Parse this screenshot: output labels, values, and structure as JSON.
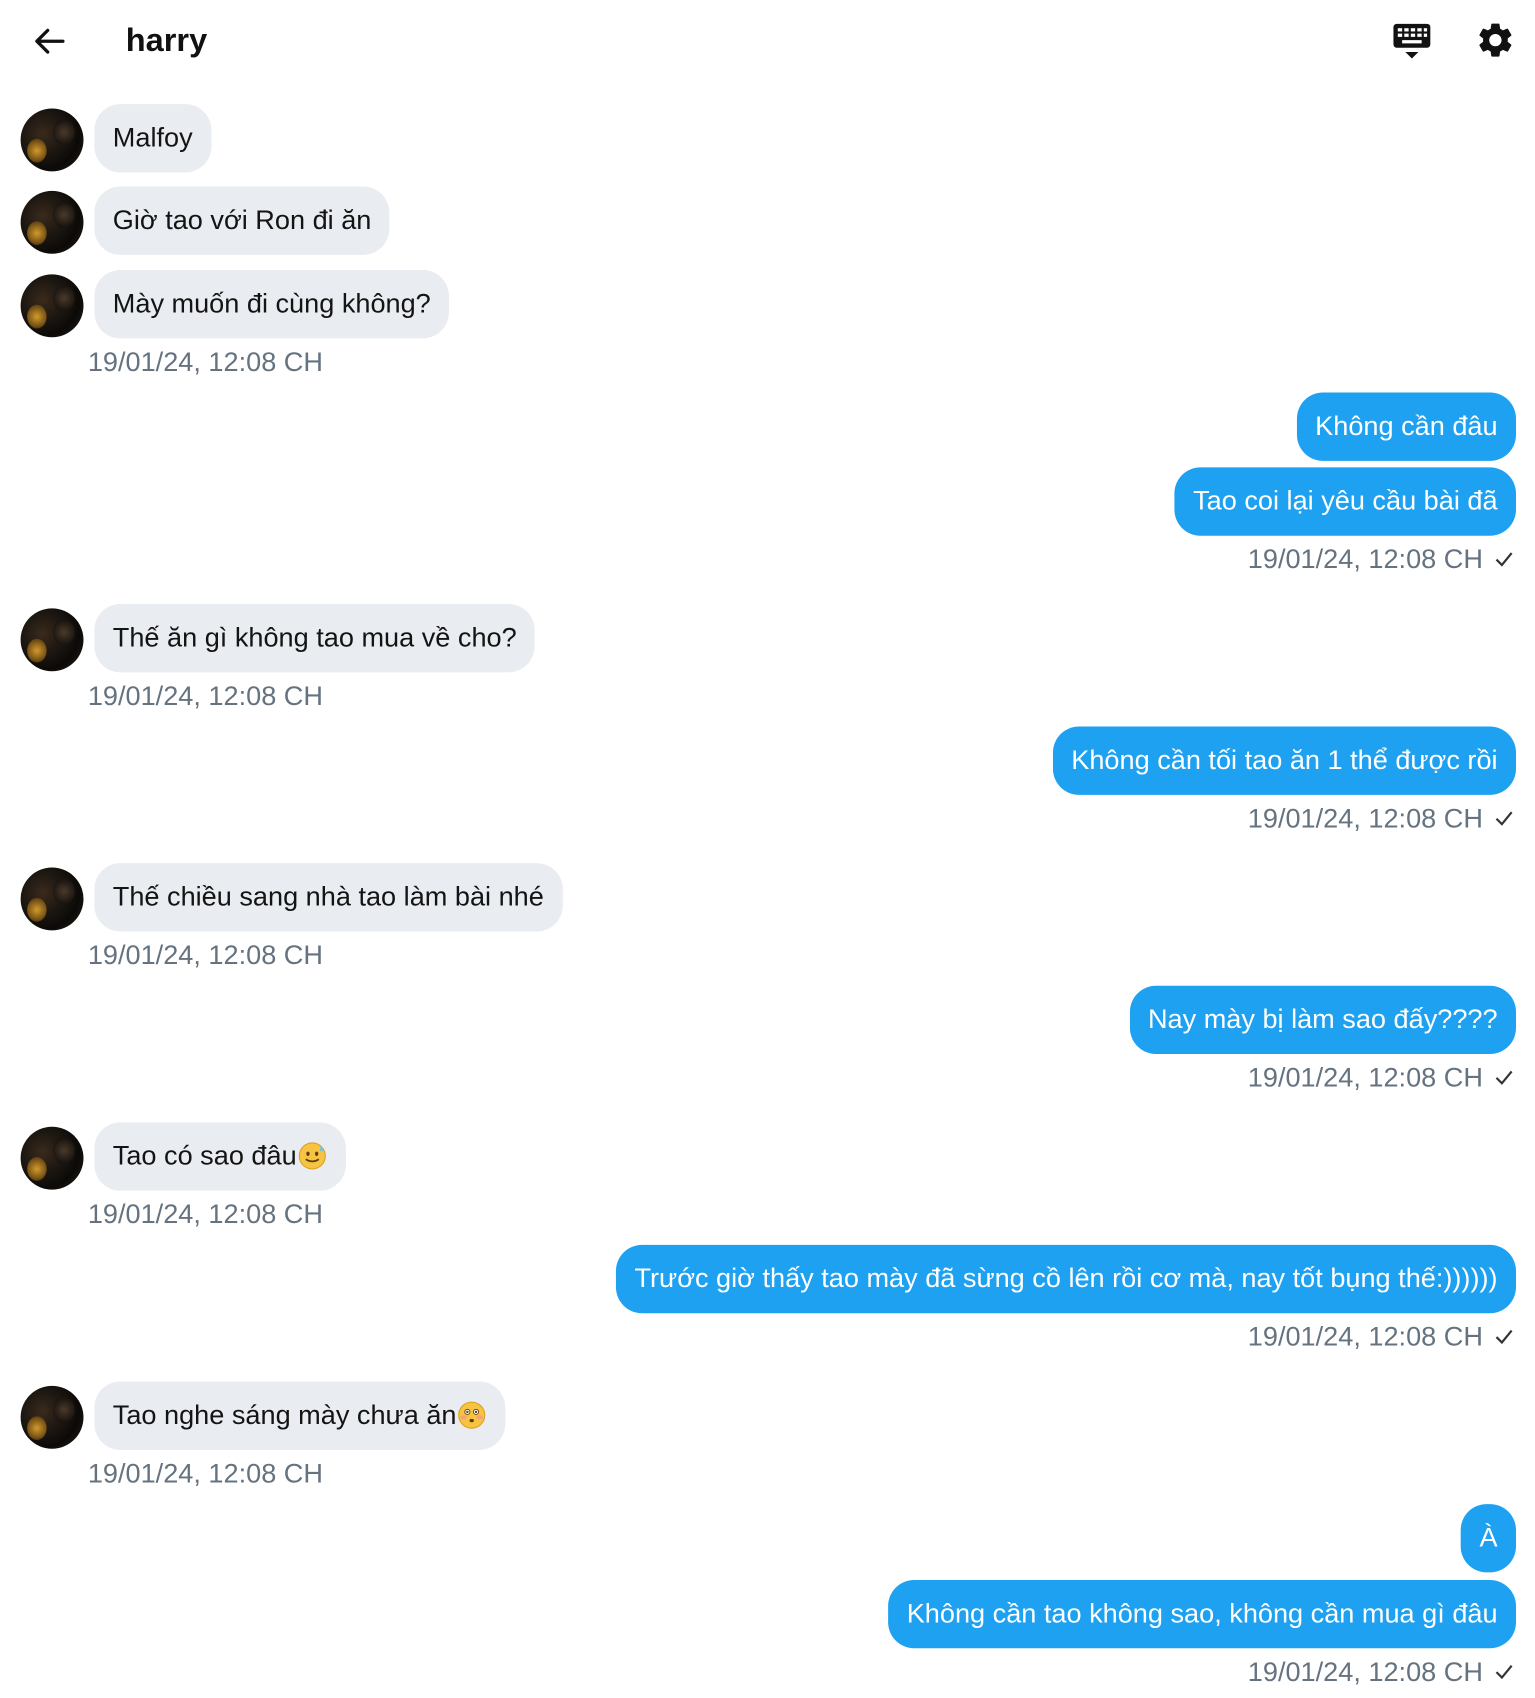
{
  "header": {
    "title": "harry",
    "back_icon": "arrow-left-icon",
    "keyboard_icon": "keyboard-icon",
    "settings_icon": "gear-icon"
  },
  "colors": {
    "outgoing_bubble": "#1ea1f1",
    "incoming_bubble": "#e9ecf0",
    "timestamp": "#657380"
  },
  "messages": [
    {
      "dir": "in",
      "text": "Malfoy"
    },
    {
      "dir": "in",
      "text": "Giờ tao với Ron đi ăn"
    },
    {
      "dir": "in",
      "text": "Mày muốn đi cùng không?"
    },
    {
      "dir": "in",
      "timestamp": "19/01/24, 12:08 CH"
    },
    {
      "dir": "out",
      "text": "Không cần đâu"
    },
    {
      "dir": "out",
      "text": "Tao coi lại yêu cầu bài đã"
    },
    {
      "dir": "out",
      "timestamp": "19/01/24, 12:08 CH"
    },
    {
      "dir": "in",
      "text": "Thế ăn gì không tao mua về cho?"
    },
    {
      "dir": "in",
      "timestamp": "19/01/24, 12:08 CH"
    },
    {
      "dir": "out",
      "text": "Không cần tối tao ăn 1 thể được rồi"
    },
    {
      "dir": "out",
      "timestamp": "19/01/24, 12:08 CH"
    },
    {
      "dir": "in",
      "text": "Thế chiều sang nhà tao làm bài nhé"
    },
    {
      "dir": "in",
      "timestamp": "19/01/24, 12:08 CH"
    },
    {
      "dir": "out",
      "text": "Nay mày bị làm sao đấy????"
    },
    {
      "dir": "out",
      "timestamp": "19/01/24, 12:08 CH"
    },
    {
      "dir": "in",
      "text": "Tao có sao đâu",
      "emoji": "sweat-smile-face-emoji"
    },
    {
      "dir": "in",
      "timestamp": "19/01/24, 12:08 CH"
    },
    {
      "dir": "out",
      "text": "Trước giờ thấy tao mày đã sừng cồ lên rồi cơ mà, nay tốt bụng thế:))))))"
    },
    {
      "dir": "out",
      "timestamp": "19/01/24, 12:08 CH"
    },
    {
      "dir": "in",
      "text": "Tao nghe sáng mày chưa ăn",
      "emoji": "flushed-face-emoji"
    },
    {
      "dir": "in",
      "timestamp": "19/01/24, 12:08 CH"
    },
    {
      "dir": "out",
      "text": "À"
    },
    {
      "dir": "out",
      "text": "Không cần tao không sao, không cần mua gì đâu"
    },
    {
      "dir": "out",
      "timestamp": "19/01/24, 12:08 CH"
    }
  ]
}
